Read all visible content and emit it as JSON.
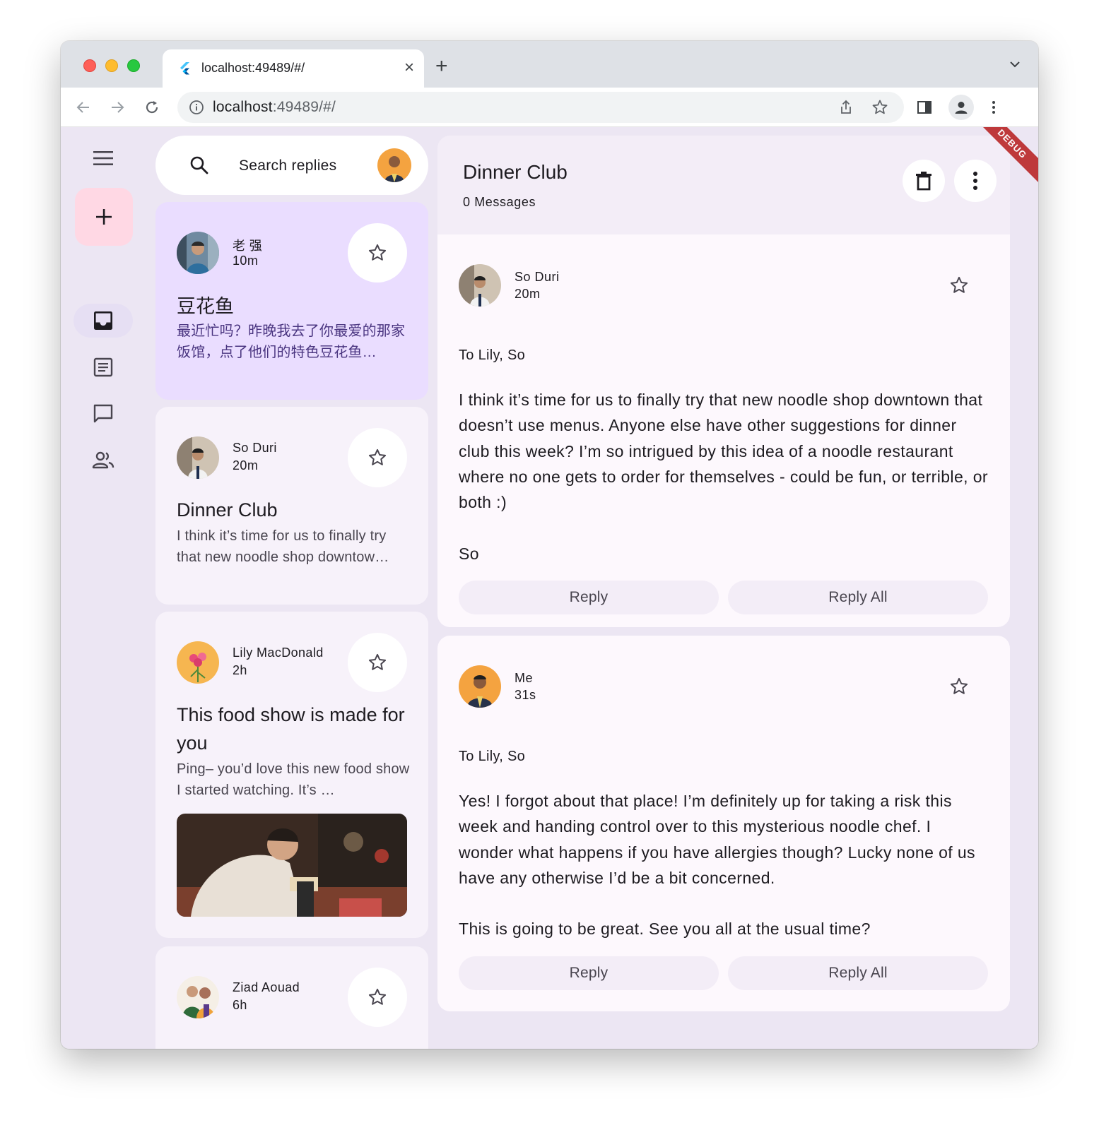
{
  "browser": {
    "tab_title": "localhost:49489/#/",
    "url_host": "localhost",
    "url_path": ":49489/#/",
    "close_glyph": "×",
    "newtab_glyph": "+"
  },
  "debug_banner": "DEBUG",
  "search": {
    "placeholder": "Search replies"
  },
  "emails": [
    {
      "sender": "老 强",
      "time": "10m",
      "subject": "豆花鱼",
      "preview": "最近忙吗？昨晚我去了你最爱的那家饭馆，点了他们的特色豆花鱼…",
      "selected": true
    },
    {
      "sender": "So Duri",
      "time": "20m",
      "subject": "Dinner Club",
      "preview": "I think it’s time for us to finally try that new noodle shop downtow…"
    },
    {
      "sender": "Lily MacDonald",
      "time": "2h",
      "subject": "This food show is made for you",
      "preview": "Ping– you’d love this new food show I started watching. It’s …"
    },
    {
      "sender": "Ziad Aouad",
      "time": "6h"
    }
  ],
  "detail": {
    "title": "Dinner Club",
    "count": "0 Messages",
    "messages": [
      {
        "sender": "So Duri",
        "time": "20m",
        "to": "To Lily, So",
        "body": "I think it’s time for us to finally try that new noodle shop downtown that doesn’t use menus. Anyone else have other suggestions for dinner club this week? I’m so intrigued by this idea of a noodle restaurant where no one gets to order for themselves - could be fun, or terrible, or both :)\n\nSo",
        "reply": "Reply",
        "reply_all": "Reply All"
      },
      {
        "sender": "Me",
        "time": "31s",
        "to": "To Lily, So",
        "body": "Yes! I forgot about that place! I’m definitely up for taking a risk this week and handing control over to this mysterious noodle chef. I wonder what happens if you have allergies though? Lucky none of us have any otherwise I’d be a bit concerned.\n\nThis is going to be great. See you all at the usual time?",
        "reply": "Reply",
        "reply_all": "Reply All"
      }
    ]
  },
  "colors": {
    "background": "#ece6f3",
    "selected_card": "#eaddff",
    "fab": "#ffd8e4",
    "card": "#f7f2fa",
    "message": "#fdf8fd"
  },
  "icons": {
    "rail": [
      "menu-icon",
      "compose-icon",
      "inbox-icon",
      "articles-icon",
      "chat-icon",
      "contacts-icon"
    ],
    "header": [
      "delete-icon",
      "more-vert-icon"
    ]
  }
}
